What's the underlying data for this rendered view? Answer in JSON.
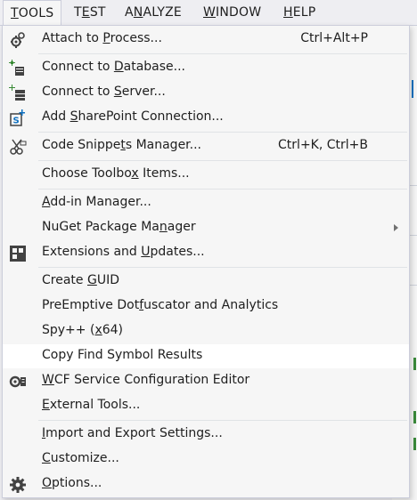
{
  "menubar": {
    "items": [
      "TOOLS",
      "TEST",
      "ANALYZE",
      "WINDOW",
      "HELP"
    ]
  },
  "menu": {
    "items": [
      {
        "label": "Attach to Process...",
        "shortcut": "Ctrl+Alt+P",
        "icon": "gear-attach-icon"
      },
      {
        "label": "Connect to Database...",
        "icon": "database-connect-icon"
      },
      {
        "label": "Connect to Server...",
        "icon": "server-connect-icon"
      },
      {
        "label": "Add SharePoint Connection...",
        "icon": "sharepoint-icon"
      },
      {
        "label": "Code Snippets Manager...",
        "shortcut": "Ctrl+K, Ctrl+B",
        "icon": "snippets-icon"
      },
      {
        "label": "Choose Toolbox Items..."
      },
      {
        "label": "Add-in Manager..."
      },
      {
        "label": "NuGet Package Manager",
        "submenu": true
      },
      {
        "label": "Extensions and Updates...",
        "icon": "extensions-icon"
      },
      {
        "label": "Create GUID"
      },
      {
        "label": "PreEmptive Dotfuscator and Analytics"
      },
      {
        "label": "Spy++ (x64)"
      },
      {
        "label": "Copy Find Symbol Results",
        "highlighted": true
      },
      {
        "label": "WCF Service Configuration Editor",
        "icon": "wcf-config-icon"
      },
      {
        "label": "External Tools..."
      },
      {
        "label": "Import and Export Settings..."
      },
      {
        "label": "Customize..."
      },
      {
        "label": "Options...",
        "icon": "options-gear-icon"
      }
    ]
  },
  "colors": {
    "menu_bg": "#f6f6f6",
    "hover_bg": "#ffffff",
    "border": "#cccedb",
    "text": "#1e1e1e"
  }
}
